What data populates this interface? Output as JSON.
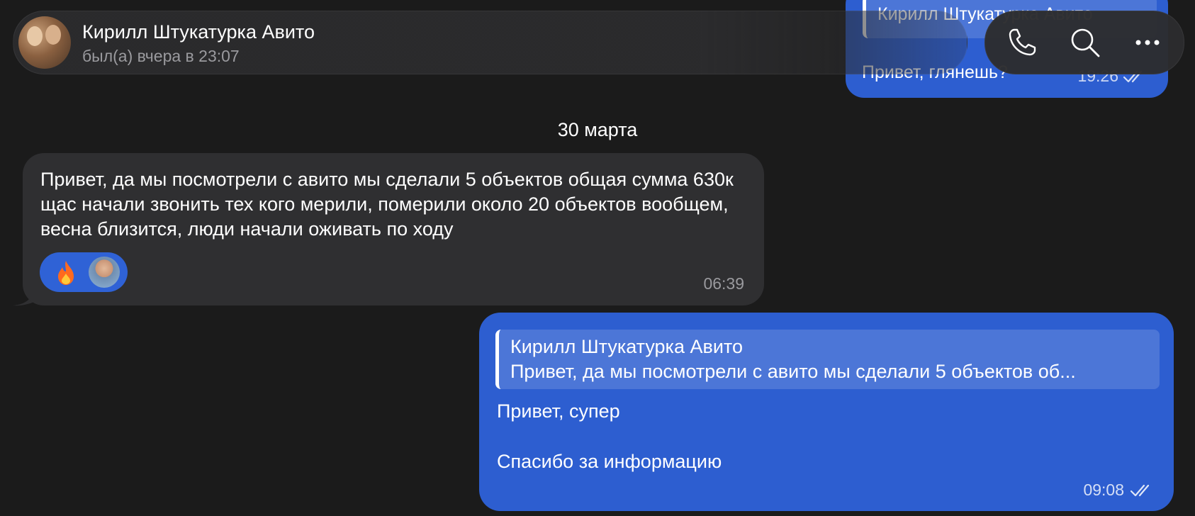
{
  "previous_message": {
    "quote_name": "Кирилл Штукатурка Авито",
    "text": "Привет, глянешь?",
    "time": "19:26"
  },
  "header": {
    "contact_name": "Кирилл Штукатурка Авито",
    "status": "был(а) вчера в 23:07"
  },
  "date_separator": "30 марта",
  "incoming_message": {
    "text": "Привет, да мы посмотрели с авито мы сделали 5 объектов общая сумма 630к щас начали звонить тех кого мерили, померили около 20 объектов вообщем, весна близится, люди начали оживать по ходу",
    "time": "06:39",
    "reaction_emoji": "🔥"
  },
  "outgoing_message": {
    "quote_name": "Кирилл Штукатурка Авито",
    "quote_text": "Привет, да мы посмотрели с авито мы сделали 5 объектов об...",
    "line1": "Привет, супер",
    "line2": "Спасибо за информацию",
    "time": "09:08"
  },
  "colors": {
    "background": "#1b1b1b",
    "incoming_bubble": "#2f2f31",
    "outgoing_bubble": "#2d5ed0",
    "secondary_text": "#9a9a9e"
  },
  "icons": [
    "phone-icon",
    "search-icon",
    "more-icon",
    "double-check-icon",
    "fire-icon"
  ]
}
